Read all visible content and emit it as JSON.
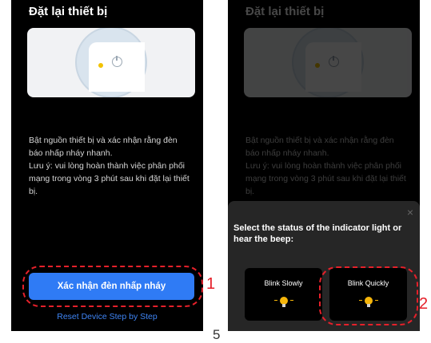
{
  "left": {
    "title": "Đặt lại thiết bị",
    "text_line1": "Bật nguồn thiết bị và xác nhận rằng đèn báo nhấp nháy nhanh.",
    "text_line2": "Lưu ý: vui lòng hoàn thành việc phân phối mạng trong vòng 3 phút sau khi đặt lại thiết bị.",
    "confirm_button": "Xác nhận đèn nhấp nháy",
    "reset_link": "Reset Device Step by Step",
    "marker": "1"
  },
  "right": {
    "title": "Đặt lại thiết bị",
    "text_line1": "Bật nguồn thiết bị và xác nhận rằng đèn báo nhấp nháy nhanh.",
    "text_line2": "Lưu ý: vui lòng hoàn thành việc phân phối mạng trong vòng 3 phút sau khi đặt lại thiết bị.",
    "sheet": {
      "close": "×",
      "title": "Select the status of the indicator light or hear the beep:",
      "option_slow": "Blink Slowly",
      "option_quick": "Blink Quickly"
    },
    "marker": "2"
  },
  "step_number": "5",
  "colors": {
    "accent": "#2f7bf5",
    "annotation": "#e5202a",
    "led": "#f2c200"
  },
  "icons": [
    "power-icon",
    "led-indicator-icon",
    "close-icon",
    "bulb-icon"
  ]
}
